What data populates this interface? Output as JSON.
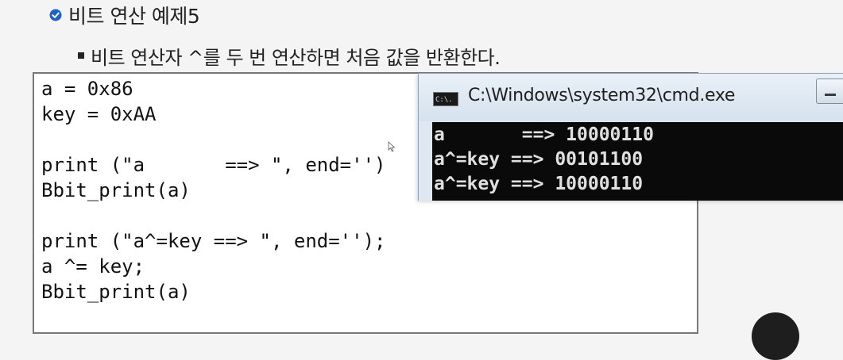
{
  "slide": {
    "heading": "비트 연산 예제5",
    "subbullet": "비트 연산자 ^를 두 번 연산하면 처음 값을 반환한다."
  },
  "code": {
    "lines": [
      "a = 0x86",
      "key = 0xAA",
      "",
      "print (\"a       ==> \", end='')",
      "Bbit_print(a)",
      "",
      "print (\"a^=key ==> \", end='');",
      "a ^= key;",
      "Bbit_print(a)"
    ]
  },
  "cmd": {
    "title": "C:\\Windows\\system32\\cmd.exe",
    "icon_label": "C:\\.",
    "output": [
      "a       ==> 10000110",
      "a^=key ==> 00101100",
      "a^=key ==> 10000110"
    ]
  },
  "colors": {
    "heading_icon": "#1e63c8",
    "console_bg": "#0a0a0a",
    "console_text": "#e0e0e0"
  }
}
